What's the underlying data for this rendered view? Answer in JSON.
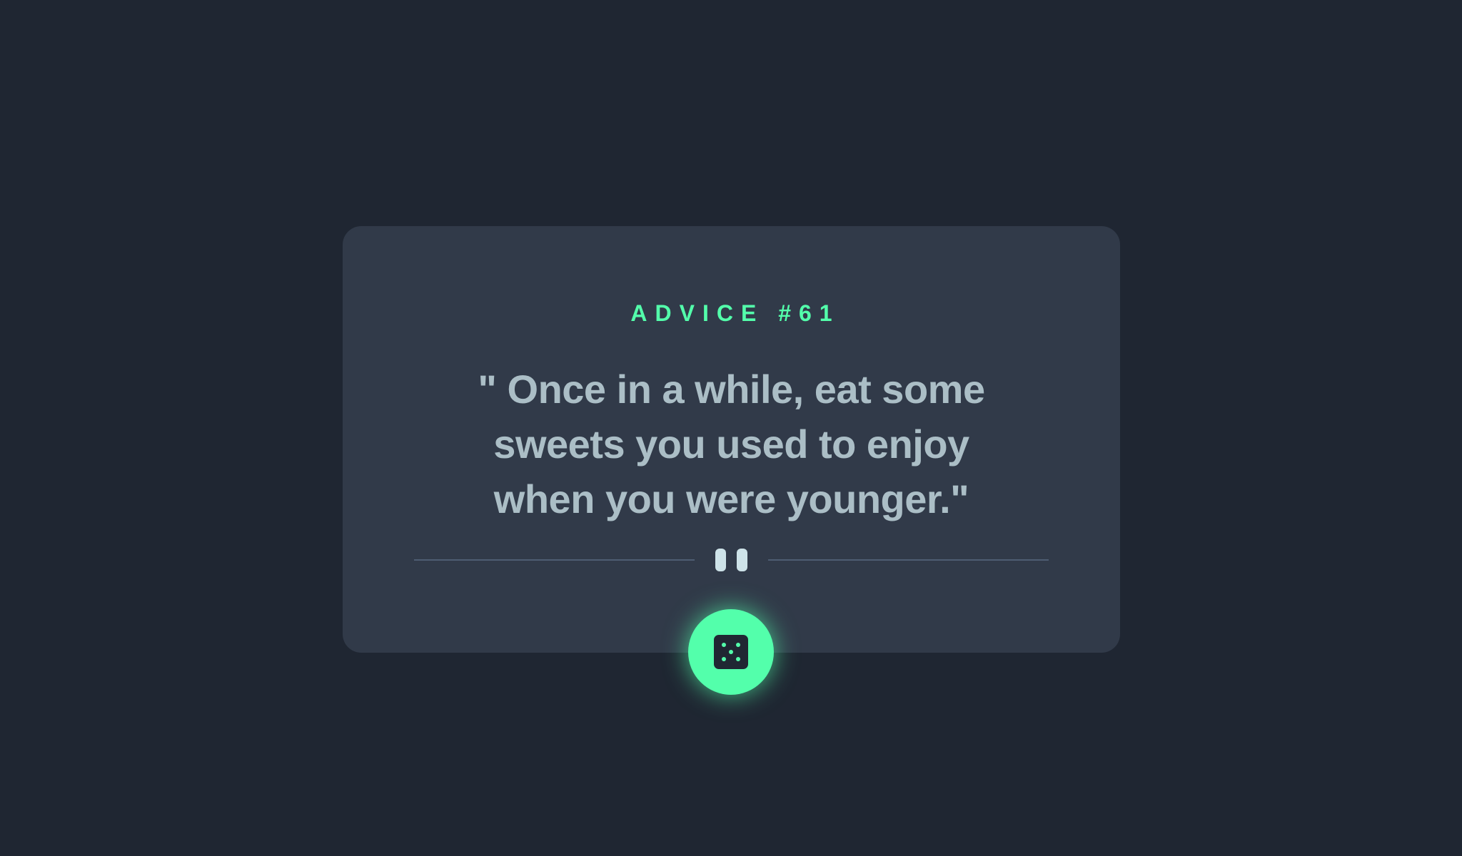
{
  "advice": {
    "title": "ADVICE #61",
    "quote": "\" Once in a while, eat some sweets you used to enjoy when you were younger.\""
  },
  "icons": {
    "divider": "pause-icon",
    "button": "dice-icon"
  },
  "colors": {
    "background": "#1f2632",
    "card": "#313a49",
    "accent": "#53ffab",
    "text": "#cee3e9",
    "divider": "#4e5d73"
  }
}
